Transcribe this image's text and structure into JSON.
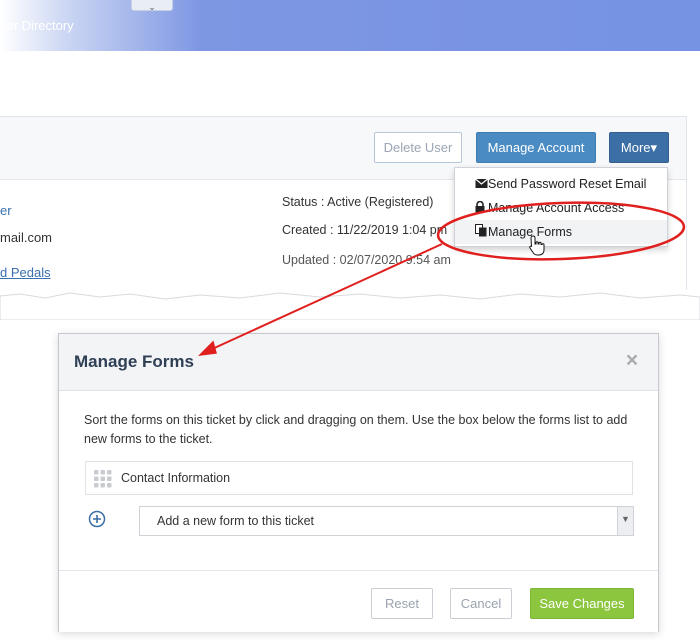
{
  "header": {
    "title": "ser Directory"
  },
  "user_panel": {
    "buttons": {
      "delete": "Delete User",
      "manage_account": "Manage Account",
      "more": "More▾"
    },
    "left_info": {
      "line1": "er",
      "line2": "mail.com",
      "line3": "d Pedals"
    },
    "status": "Status : Active (Registered)",
    "created": "Created : 11/22/2019 1:04 pm",
    "updated": "Updated : 02/07/2020 9:54 am"
  },
  "more_menu": {
    "items": [
      {
        "label": "Send Password Reset Email",
        "icon": "envelope-icon"
      },
      {
        "label": "Manage Account Access",
        "icon": "lock-icon"
      },
      {
        "label": "Manage Forms",
        "icon": "copy-icon"
      }
    ]
  },
  "modal": {
    "title": "Manage Forms",
    "close_glyph": "×",
    "description": "Sort the forms on this ticket by click and dragging on them. Use the box below the forms list to add new forms to the ticket.",
    "forms": [
      {
        "label": "Contact Information"
      }
    ],
    "add_select": {
      "selected": "Add a new form to this ticket"
    },
    "footer": {
      "reset": "Reset",
      "cancel": "Cancel",
      "save": "Save Changes"
    }
  },
  "colors": {
    "header_blue": "#7592e3",
    "primary_button": "#4a8bc3",
    "more_button": "#3d6fa7",
    "save_button": "#8cc63f",
    "annotation_red": "#e0201e"
  }
}
